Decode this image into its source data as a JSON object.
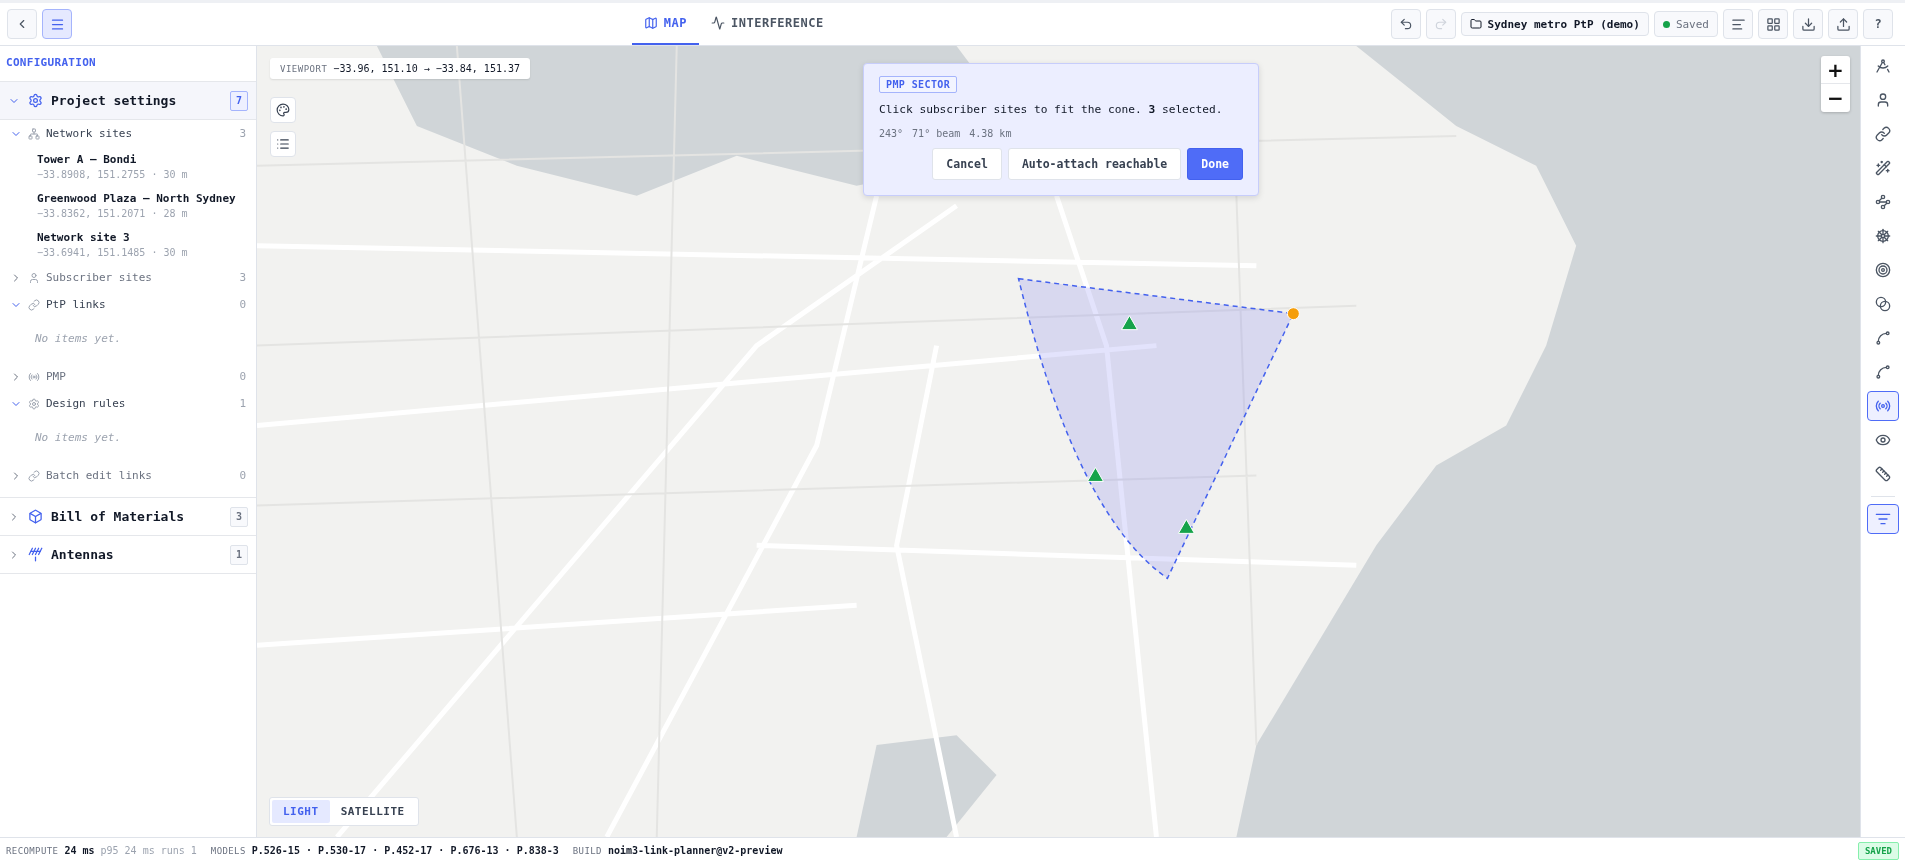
{
  "topbar": {
    "menu_button": {
      "selected": true
    },
    "tabs": [
      {
        "label": "MAP",
        "selected": true
      },
      {
        "label": "INTERFERENCE",
        "selected": false
      }
    ],
    "undo": {
      "disabled": false
    },
    "redo": {
      "disabled": true
    },
    "project": {
      "name": "Sydney metro PtP (demo)"
    },
    "save_status": {
      "label": "Saved",
      "color": "#16a34a"
    },
    "help": {
      "label": "?"
    }
  },
  "sidebar": {
    "title": "CONFIGURATION",
    "sections": [
      {
        "title": "Project settings",
        "count": "7",
        "expanded": true,
        "groups": [
          {
            "label": "Network sites",
            "count": "3",
            "expanded": true,
            "items": [
              {
                "name": "Tower A — Bondi",
                "detail": "−33.8908, 151.2755 · 30 m"
              },
              {
                "name": "Greenwood Plaza — North Sydney",
                "detail": "−33.8362, 151.2071 · 28 m"
              },
              {
                "name": "Network site 3",
                "detail": "−33.6941, 151.1485 · 30 m"
              }
            ]
          },
          {
            "label": "Subscriber sites",
            "count": "3",
            "expanded": false
          },
          {
            "label": "PtP links",
            "count": "0",
            "expanded": true,
            "empty": "No items yet."
          },
          {
            "label": "PMP",
            "count": "0",
            "expanded": false
          },
          {
            "label": "Design rules",
            "count": "1",
            "expanded": true,
            "empty": "No items yet."
          },
          {
            "label": "Batch edit links",
            "count": "0",
            "expanded": false
          }
        ]
      },
      {
        "title": "Bill of Materials",
        "count": "3",
        "expanded": false
      },
      {
        "title": "Antennas",
        "count": "1",
        "expanded": false
      }
    ]
  },
  "map": {
    "viewport": {
      "label": "VIEWPORT",
      "value": "−33.96, 151.10 → −33.84, 151.37"
    },
    "zoom_in": "+",
    "zoom_out": "−",
    "basemaps": [
      {
        "label": "LIGHT",
        "selected": true
      },
      {
        "label": "SATELLITE",
        "selected": false
      }
    ],
    "sector_popup": {
      "tag": "PMP SECTOR",
      "message": "Click subscriber sites to fit the cone. **3** selected.",
      "stats": [
        "243°",
        "71° beam",
        "4.38 km"
      ],
      "buttons": [
        {
          "label": "Cancel",
          "kind": "secondary"
        },
        {
          "label": "Auto-attach reachable",
          "kind": "secondary"
        },
        {
          "label": "Done",
          "kind": "primary"
        }
      ]
    }
  },
  "tools": [
    {
      "selected": false
    },
    {
      "selected": false
    },
    {
      "selected": false
    },
    {
      "selected": false
    },
    {
      "selected": false
    },
    {
      "selected": false
    },
    {
      "selected": false
    },
    {
      "selected": false
    },
    {
      "selected": false
    },
    {
      "selected": false
    },
    {
      "selected": true
    },
    {
      "selected": false
    },
    {
      "selected": false
    }
  ],
  "filter_tool": {
    "selected": true
  },
  "status_bar": {
    "recompute": {
      "label": "RECOMPUTE",
      "value": "24 ms",
      "detail": "p95 24 ms runs 1"
    },
    "models": {
      "label": "MODELS",
      "value": "P.526-15 · P.530-17 · P.452-17 · P.676-13 · P.838-3"
    },
    "build": {
      "label": "BUILD",
      "value": "noim3-link-planner@v2-preview"
    },
    "badge": "SAVED"
  }
}
